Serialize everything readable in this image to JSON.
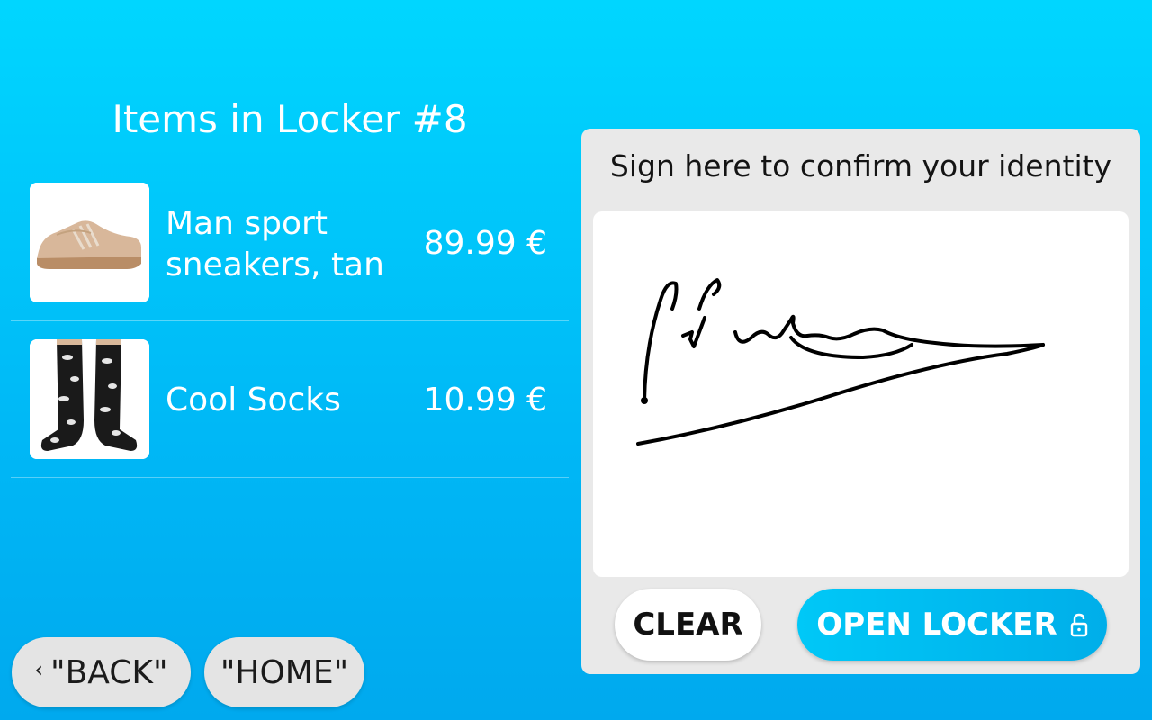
{
  "locker": {
    "title": "Items in Locker #8"
  },
  "items": [
    {
      "name": "Man sport sneakers, tan",
      "price": "89.99 €",
      "image_icon": "sneaker-image"
    },
    {
      "name": "Cool Socks",
      "price": "10.99 €",
      "image_icon": "socks-image"
    }
  ],
  "nav": {
    "back_label": "\"BACK\"",
    "home_label": "\"HOME\"",
    "back_icon": "chevron-left-icon"
  },
  "signature": {
    "prompt": "Sign here to confirm your identity",
    "clear_label": "CLEAR",
    "open_label": "OPEN LOCKER",
    "open_icon": "lock-icon"
  },
  "colors": {
    "background_top": "#00d6ff",
    "background_bottom": "#00a9ee",
    "panel": "#e9e9e9",
    "accent": "#00c8f7"
  }
}
